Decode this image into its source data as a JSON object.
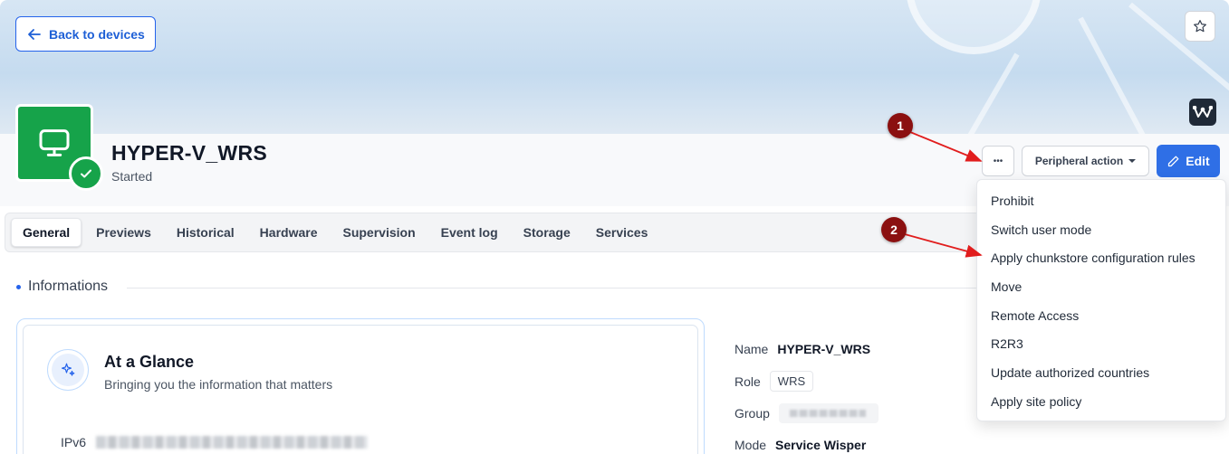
{
  "header": {
    "back_label": "Back to devices",
    "device_name": "HYPER-V_WRS",
    "device_status": "Started"
  },
  "actions": {
    "more_label": "•••",
    "peripheral_label": "Peripheral action",
    "edit_label": "Edit"
  },
  "tabs": [
    {
      "label": "General",
      "active": true
    },
    {
      "label": "Previews"
    },
    {
      "label": "Historical"
    },
    {
      "label": "Hardware"
    },
    {
      "label": "Supervision"
    },
    {
      "label": "Event log"
    },
    {
      "label": "Storage"
    },
    {
      "label": "Services"
    }
  ],
  "section": {
    "title": "Informations"
  },
  "glance": {
    "title": "At a Glance",
    "subtitle": "Bringing you the information that matters",
    "ipv6_label": "IPv6"
  },
  "properties": {
    "name_label": "Name",
    "name_value": "HYPER-V_WRS",
    "role_label": "Role",
    "role_value": "WRS",
    "group_label": "Group",
    "mode_label": "Mode",
    "mode_value": "Service Wisper"
  },
  "menu": {
    "items": [
      "Prohibit",
      "Switch user mode",
      "Apply chunkstore configuration rules",
      "Move",
      "Remote Access",
      "R2R3",
      "Update authorized countries",
      "Apply site policy"
    ]
  },
  "callouts": [
    "1",
    "2"
  ],
  "colors": {
    "accent": "#2f6fe6",
    "success": "#16a34a",
    "callout": "#8b1010"
  }
}
